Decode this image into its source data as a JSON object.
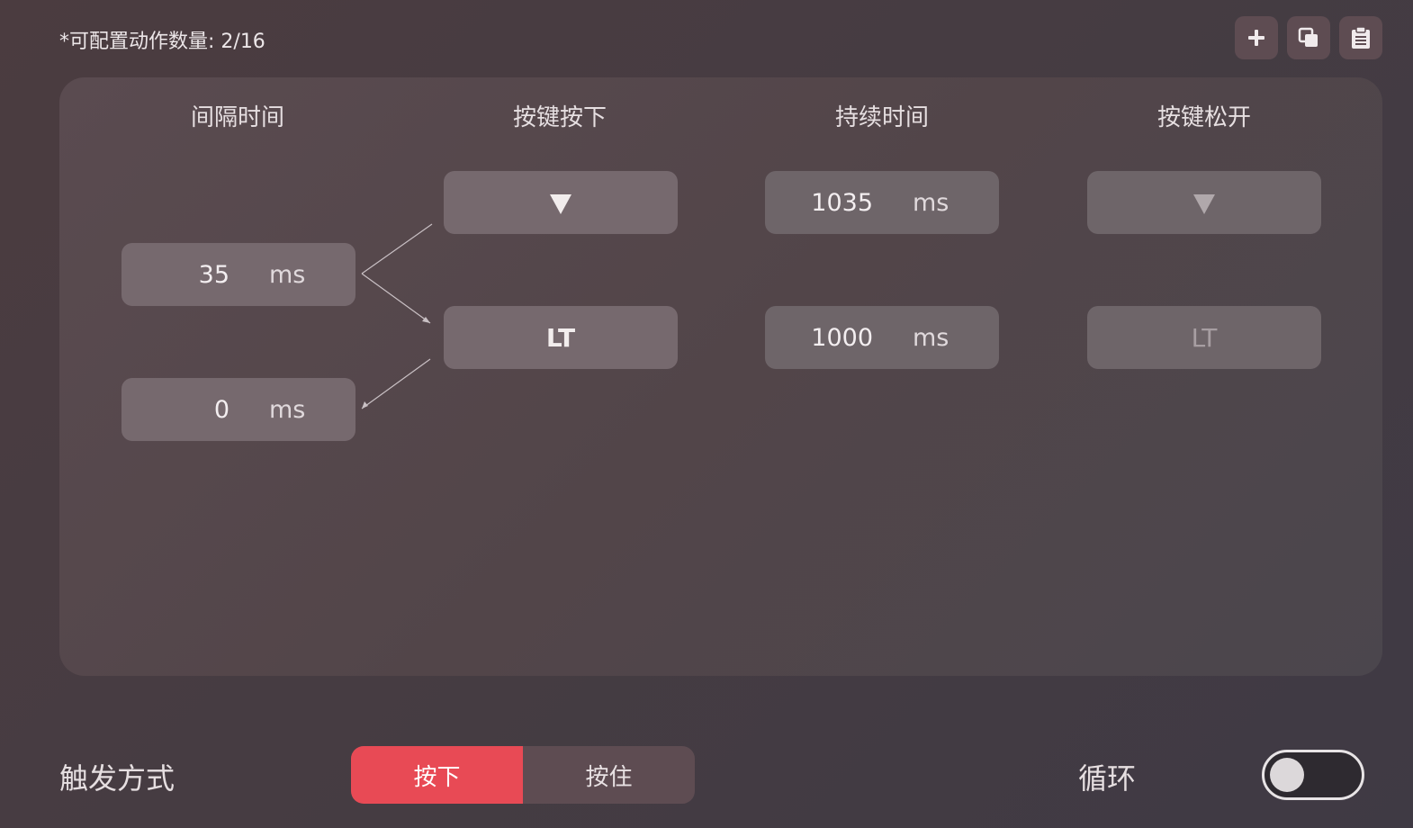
{
  "header": {
    "quota_label": "*可配置动作数量: 2/16"
  },
  "toolbar": {
    "buttons": [
      {
        "name": "add",
        "icon": "plus-icon"
      },
      {
        "name": "copy",
        "icon": "copy-icon"
      },
      {
        "name": "paste",
        "icon": "clipboard-icon"
      }
    ]
  },
  "table": {
    "columns": [
      "间隔时间",
      "按键按下",
      "持续时间",
      "按键松开"
    ],
    "intervals": [
      {
        "value": "35",
        "unit": "ms"
      },
      {
        "value": "0",
        "unit": "ms"
      }
    ],
    "actions": [
      {
        "press": "",
        "press_icon": "triangle-down-icon",
        "duration": "1035",
        "duration_unit": "ms",
        "release": "",
        "release_icon": "triangle-down-icon"
      },
      {
        "press": "LT",
        "duration": "1000",
        "duration_unit": "ms",
        "release": "LT"
      }
    ]
  },
  "trigger": {
    "label": "触发方式",
    "options": [
      "按下",
      "按住"
    ],
    "selected": "按下"
  },
  "loop": {
    "label": "循环",
    "enabled": false
  },
  "colors": {
    "accent": "#e84a55",
    "panel": "#54474b",
    "cell": "#76696e"
  }
}
